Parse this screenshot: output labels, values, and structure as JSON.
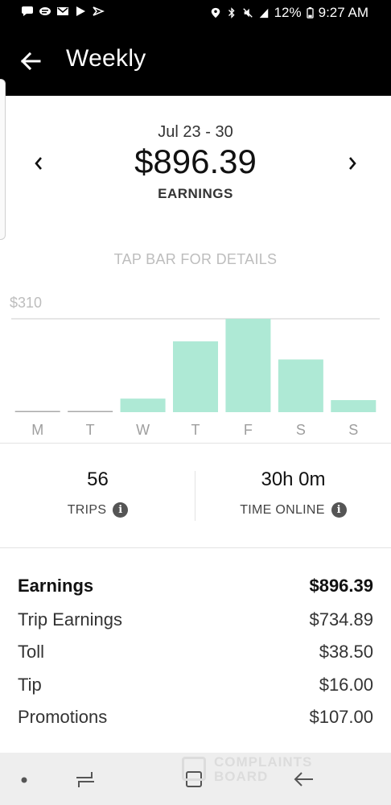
{
  "status_bar": {
    "battery": "12%",
    "time": "9:27 AM",
    "icons": [
      "message-icon",
      "chat-icon",
      "mail-icon",
      "play-icon",
      "sprint-icon",
      "location-icon",
      "bluetooth-icon",
      "mute-icon",
      "signal-icon",
      "battery-icon"
    ]
  },
  "app_bar": {
    "title": "Weekly",
    "back_icon": "arrow-left-icon"
  },
  "summary": {
    "date_range": "Jul 23 - 30",
    "total": "$896.39",
    "total_label": "EARNINGS",
    "prev_icon": "chevron-left-icon",
    "next_icon": "chevron-right-icon"
  },
  "hint": "TAP BAR FOR DETAILS",
  "chart_data": {
    "type": "bar",
    "ymax_label": "$310",
    "ylim": [
      0,
      310
    ],
    "categories": [
      "M",
      "T",
      "W",
      "T",
      "F",
      "S",
      "S"
    ],
    "values": [
      0,
      0,
      45,
      235,
      310,
      175,
      40
    ],
    "bar_color": "#aee9d5",
    "grid": false
  },
  "stats": {
    "trips_value": "56",
    "trips_label": "TRIPS",
    "time_value": "30h 0m",
    "time_label": "TIME ONLINE",
    "info_glyph": "i"
  },
  "breakdown": {
    "header": {
      "label": "Earnings",
      "value": "$896.39"
    },
    "rows": [
      {
        "label": "Trip Earnings",
        "value": "$734.89"
      },
      {
        "label": "Toll",
        "value": "$38.50"
      },
      {
        "label": "Tip",
        "value": "$16.00"
      },
      {
        "label": "Promotions",
        "value": "$107.00"
      }
    ]
  },
  "watermark": {
    "line1": "COMPLAINTS",
    "line2": "BOARD"
  },
  "nav_bar": {
    "icons": [
      "dot-icon",
      "recent-apps-icon",
      "home-icon",
      "back-icon"
    ]
  }
}
